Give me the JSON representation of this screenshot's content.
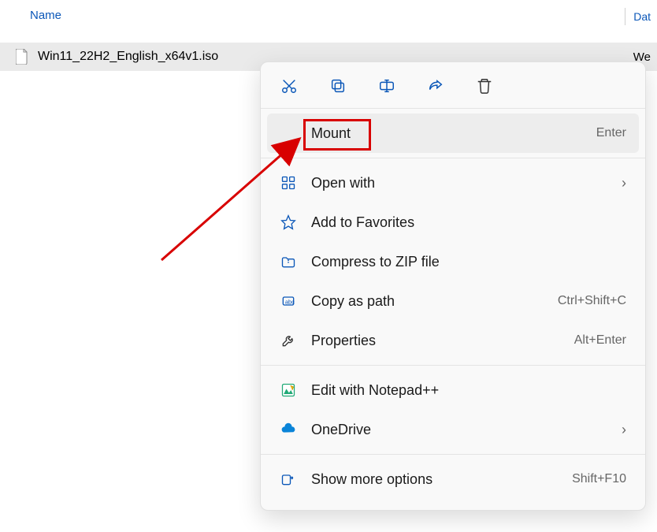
{
  "header": {
    "name_col": "Name",
    "date_col": "Dat"
  },
  "file": {
    "name": "Win11_22H2_English_x64v1.iso",
    "date_partial": "We"
  },
  "quick_actions": {
    "cut": "cut-icon",
    "copy": "copy-icon",
    "rename": "rename-icon",
    "share": "share-icon",
    "delete": "delete-icon"
  },
  "menu": {
    "mount": {
      "label": "Mount",
      "shortcut": "Enter"
    },
    "open_with": {
      "label": "Open with"
    },
    "favorites": {
      "label": "Add to Favorites"
    },
    "compress": {
      "label": "Compress to ZIP file"
    },
    "copy_path": {
      "label": "Copy as path",
      "shortcut": "Ctrl+Shift+C"
    },
    "properties": {
      "label": "Properties",
      "shortcut": "Alt+Enter"
    },
    "notepadpp": {
      "label": "Edit with Notepad++"
    },
    "onedrive": {
      "label": "OneDrive"
    },
    "more": {
      "label": "Show more options",
      "shortcut": "Shift+F10"
    }
  }
}
